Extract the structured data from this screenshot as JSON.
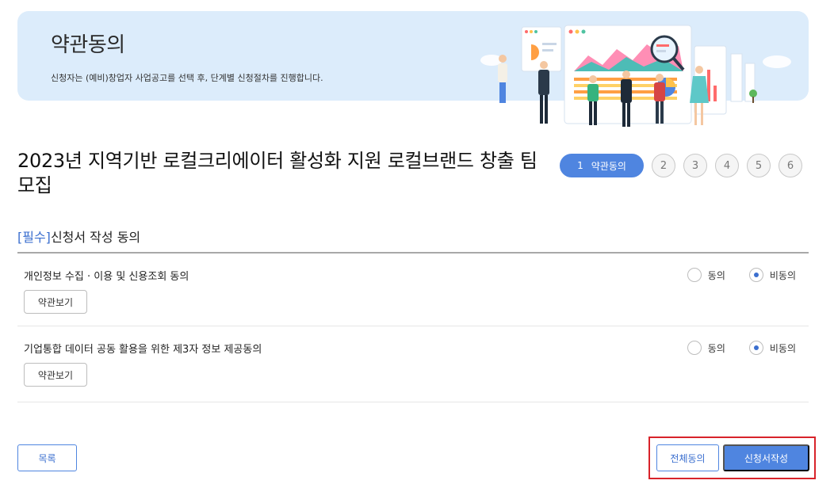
{
  "banner": {
    "title": "약관동의",
    "subtitle": "신청자는 (예비)창업자 사업공고를 선택 후, 단계별 신청절차를 진행합니다."
  },
  "page": {
    "title": "2023년 지역기반 로컬크리에이터 활성화 지원 로컬브랜드 창출 팀 모집"
  },
  "steps": {
    "active_number": "1",
    "active_label": "약관동의",
    "items": [
      "2",
      "3",
      "4",
      "5",
      "6"
    ]
  },
  "section": {
    "required_tag": "[필수]",
    "title": "신청서 작성 동의"
  },
  "agreements": [
    {
      "label": "개인정보 수집 · 이용 및 신용조회 동의",
      "view_button": "약관보기",
      "agree_label": "동의",
      "disagree_label": "비동의",
      "selected": "disagree"
    },
    {
      "label": "기업통합 데이터 공동 활용을 위한 제3자 정보 제공동의",
      "view_button": "약관보기",
      "agree_label": "동의",
      "disagree_label": "비동의",
      "selected": "disagree"
    }
  ],
  "buttons": {
    "list": "목록",
    "agree_all": "전체동의",
    "write_application": "신청서작성"
  },
  "colors": {
    "accent": "#4f85e0",
    "banner_bg": "#dcecfb",
    "highlight_box": "#d8232a"
  }
}
